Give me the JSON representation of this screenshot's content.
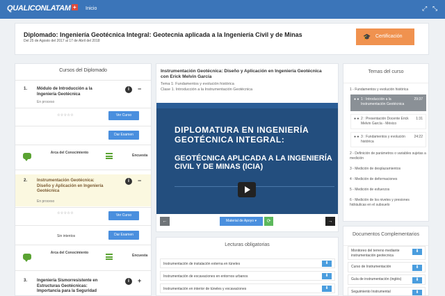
{
  "topbar": {
    "brand": "QUALICONLATAM",
    "brand_mark": "+",
    "nav_home": "Inicio",
    "expand_icon": "expand-arrows-icon",
    "compress_icon": "compress-arrows-icon"
  },
  "header": {
    "title": "Diplomado: Ingeniería Geotécnica Integral: Geotecnia aplicada a la Ingeniería Civil y de Minas",
    "dates": "Del 25 de Agosto del 2017 al 17 de Abril del 2018",
    "certificate_label": "Certificación"
  },
  "courses_panel": {
    "heading": "Cursos del Diplomado",
    "courses": [
      {
        "num": "1.",
        "title": "Módulo de Introducción a la Ingeniería Geotécnica",
        "status": "En proceso",
        "toggle": "−",
        "stars": "☆☆☆☆☆",
        "view_label": "Ver Curso",
        "exam_label": "Dar Examen",
        "arca_label": "Arca del Conocimiento",
        "survey_label": "Encuesta"
      },
      {
        "num": "2.",
        "title": "Instrumentación Geotécnica: Diseño y Aplicación en Ingeniería Geotécnica",
        "status": "En proceso",
        "toggle": "−",
        "stars": "☆☆☆☆☆",
        "attempts": "Sin intentos",
        "view_label": "Ver Curso",
        "exam_label": "Dar Examen",
        "arca_label": "Arca del Conocimiento",
        "survey_label": "Encuesta"
      },
      {
        "num": "3.",
        "title": "Ingeniería Sismorresistente en Estructuras Geotécnicas: Importancia para la Seguridad",
        "toggle": "+"
      }
    ]
  },
  "player": {
    "title": "Instrumentación Geotécnica: Diseño y Aplicación en Ingeniería Geotécnica con Erick Melvin García",
    "theme": "Tema 1: Fundamentos y evolución histórica",
    "class": "Clase 1. Introducción a la Instrumentación Geotécnica",
    "video_line1": "DIPLOMATURA EN INGENIERÍA GEOTÉCNICA INTEGRAL:",
    "video_line2": "GEOTÉCNICA APLICADA A LA INGENIERÍA CIVIL Y DE MINAS (ICIA)",
    "prev": "←",
    "next": "→",
    "material_label": "Material de Apoyo ▾",
    "refresh": "⟳"
  },
  "readings": {
    "heading": "Lecturas obligatorias",
    "items": [
      "Instrumentación de instalación externa en túneles",
      "Instrumentación de excavaciones en entornos urbanos",
      "Instrumentación en interior de túneles y excavaciones"
    ],
    "download_icon": "⬇"
  },
  "topics_panel": {
    "heading": "Temas del curso",
    "topic1": "1 - Fundamentos y evolución histórica",
    "lessons": [
      {
        "dots": "● ●",
        "text": "1 : Introducción a la Instrumentación Geotécnica",
        "time": "29:37"
      },
      {
        "dots": "● ●",
        "text": "2 : Presentación Docente Erick Melvin García - México",
        "time": "1:31"
      },
      {
        "dots": "● ●",
        "text": "3 : Fundamentos y evolución histórica",
        "time": "24:22"
      }
    ],
    "topics_rest": [
      "2 - Definición de parámetros o variables sujetas a medición",
      "3 - Medición de desplazamientos",
      "4 - Medición de deformaciones",
      "5 - Medición de esfuerzos",
      "6 - Medición de los niveles y presiones hidráulicas en el subsuelo"
    ]
  },
  "docs_panel": {
    "heading": "Documentos Complementarios",
    "items": [
      "Monitoreo del terreno mediante instrumentación geotecnica",
      "Curso de Instrumentación",
      "Guía de instrumentación (inglés)",
      "Seguimiento Instrumental"
    ]
  }
}
